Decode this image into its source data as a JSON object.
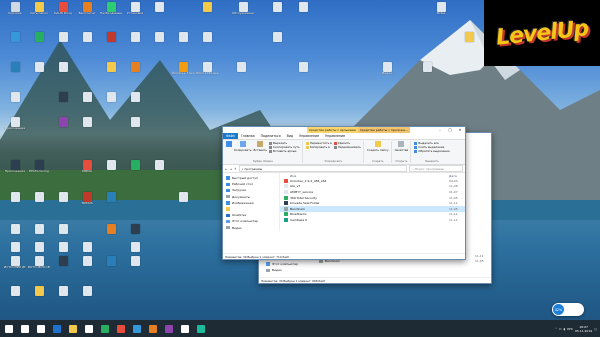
{
  "logo": {
    "text": "LevelUp"
  },
  "desktop_icons": [
    {
      "label": "Корзина",
      "color": "#cfd8e3"
    },
    {
      "label": "Сеть папок",
      "color": "#f2c94c"
    },
    {
      "label": "DAUD Drive",
      "color": "#e74c3c"
    },
    {
      "label": "Бесплатно",
      "color": "#e67e22"
    },
    {
      "label": "Необходимые MTS",
      "color": "#2ecc71"
    },
    {
      "label": "Установка",
      "color": "#dfe6ee"
    },
    {
      "label": "",
      "color": "#dfe6ee"
    },
    {
      "label": "",
      "color": "#f2c94c"
    },
    {
      "label": "Обслуживание",
      "color": "#dfe6ee"
    },
    {
      "label": "",
      "color": "#dfe6ee"
    },
    {
      "label": "",
      "color": "#dfe6ee"
    },
    {
      "label": "Notes",
      "color": "#dfe6ee"
    },
    {
      "label": "",
      "color": "#3498db"
    },
    {
      "label": "",
      "color": "#27ae60"
    },
    {
      "label": "",
      "color": "#dfe6ee"
    },
    {
      "label": "",
      "color": "#dfe6ee"
    },
    {
      "label": "",
      "color": "#c0392b"
    },
    {
      "label": "",
      "color": "#dfe6ee"
    },
    {
      "label": "",
      "color": "#dfe6ee"
    },
    {
      "label": "",
      "color": "#dfe6ee"
    },
    {
      "label": "",
      "color": "#dfe6ee"
    },
    {
      "label": "",
      "color": "#dfe6ee"
    },
    {
      "label": "",
      "color": "#f2c94c"
    },
    {
      "label": "",
      "color": "#2980b9"
    },
    {
      "label": "",
      "color": "#dfe6ee"
    },
    {
      "label": "",
      "color": "#dfe6ee"
    },
    {
      "label": "",
      "color": "#f2c94c"
    },
    {
      "label": "",
      "color": "#e67e22"
    },
    {
      "label": "Windows 7 версия",
      "color": "#f39c12"
    },
    {
      "label": "Word 2010 версия",
      "color": "#dfe6ee"
    },
    {
      "label": "",
      "color": "#dfe6ee"
    },
    {
      "label": "",
      "color": "#dfe6ee"
    },
    {
      "label": "Видео",
      "color": "#dfe6ee"
    },
    {
      "label": "",
      "color": "#dfe6ee"
    },
    {
      "label": "",
      "color": "#dfe6ee"
    },
    {
      "label": "",
      "color": "#2c3e50"
    },
    {
      "label": "",
      "color": "#dfe6ee"
    },
    {
      "label": "",
      "color": "#dfe6ee"
    },
    {
      "label": "",
      "color": "#dfe6ee"
    },
    {
      "label": "Приложение",
      "color": "#dfe6ee"
    },
    {
      "label": "",
      "color": "#8e44ad"
    },
    {
      "label": "",
      "color": "#dfe6ee"
    },
    {
      "label": "",
      "color": "#dfe6ee"
    },
    {
      "label": "Приложения",
      "color": "#2c3e50"
    },
    {
      "label": "EPCM mining",
      "color": "#2c3e50"
    },
    {
      "label": "MMMA",
      "color": "#e74c3c"
    },
    {
      "label": "",
      "color": "#dfe6ee"
    },
    {
      "label": "",
      "color": "#27ae60"
    },
    {
      "label": "",
      "color": "#dfe6ee"
    },
    {
      "label": "",
      "color": "#dfe6ee"
    },
    {
      "label": "",
      "color": "#dfe6ee"
    },
    {
      "label": "",
      "color": "#dfe6ee"
    },
    {
      "label": "TRIMUS",
      "color": "#c0392b"
    },
    {
      "label": "",
      "color": "#2980b9"
    },
    {
      "label": "",
      "color": "#dfe6ee"
    },
    {
      "label": "",
      "color": "#dfe6ee"
    },
    {
      "label": "",
      "color": "#dfe6ee"
    },
    {
      "label": "",
      "color": "#dfe6ee"
    },
    {
      "label": "",
      "color": "#e67e22"
    },
    {
      "label": "",
      "color": "#2c3e50"
    },
    {
      "label": "",
      "color": "#dfe6ee"
    },
    {
      "label": "",
      "color": "#dfe6ee"
    },
    {
      "label": "",
      "color": "#dfe6ee"
    },
    {
      "label": "",
      "color": "#dfe6ee"
    },
    {
      "label": "",
      "color": "#dfe6ee"
    },
    {
      "label": "ИСТОЧНИК ИНСТРУКЦИЯ",
      "color": "#dfe6ee"
    },
    {
      "label": "ВОТО МОЯ СЕМЬЯ",
      "color": "#dfe6ee"
    },
    {
      "label": "",
      "color": "#2c3e50"
    },
    {
      "label": "",
      "color": "#dfe6ee"
    },
    {
      "label": "",
      "color": "#2980b9"
    },
    {
      "label": "",
      "color": "#dfe6ee"
    },
    {
      "label": "",
      "color": "#dfe6ee"
    },
    {
      "label": "",
      "color": "#f2c94c"
    },
    {
      "label": "",
      "color": "#dfe6ee"
    },
    {
      "label": "",
      "color": "#dfe6ee"
    }
  ],
  "explorer_back": {
    "items": [
      {
        "name": "Kinvade Seal Folder",
        "date": "11-11"
      },
      {
        "name": "Bandicam",
        "date": "11-05"
      },
      {
        "name": "",
        "date": ""
      }
    ],
    "nav": [
      "Этот компьютер",
      "Видео"
    ],
    "status": "Элементов: 30   Выбран 1 элемент: 668 байт"
  },
  "explorer": {
    "title": "программы",
    "context_tabs": [
      "Средства работы с ярлыками",
      "Средства работы с приложе..."
    ],
    "tabs": [
      "Файл",
      "Главная",
      "Поделиться",
      "Вид",
      "Управление",
      "Управление"
    ],
    "ribbon": {
      "clipboard": {
        "pin": "Закрепить на панели быстрого доступа",
        "copy": "Копировать",
        "paste": "Вставить",
        "cut": "Вырезать",
        "copy_path": "Скопировать путь",
        "paste_shortcut": "Вставить ярлык",
        "label": "Буфер обмена"
      },
      "organize": {
        "move": "Переместить в",
        "copy": "Копировать в",
        "delete": "Удалить",
        "rename": "Переименовать",
        "label": "Упорядочить"
      },
      "new": {
        "new_folder": "Создать папку",
        "label": "Создать"
      },
      "open": {
        "properties": "Свойства",
        "label": "Открыть"
      },
      "select": {
        "all": "Выделить все",
        "none": "Снять выделение",
        "invert": "Обратить выделение",
        "label": "Выделить"
      }
    },
    "address": "« программы",
    "search_placeholder": "Поиск: программы",
    "nav": [
      {
        "label": "Быстрый доступ",
        "color": "#3d8ee8"
      },
      {
        "label": "Рабочий стол",
        "color": "#3d8ee8"
      },
      {
        "label": "Загрузки",
        "color": "#3d8ee8"
      },
      {
        "label": "Документы",
        "color": "#9aa4ae"
      },
      {
        "label": "Изображения",
        "color": "#3d8ee8"
      },
      {
        "label": "",
        "color": "#f2c94c"
      },
      {
        "label": "OneDrive",
        "color": "#1e73cf"
      },
      {
        "label": "Этот компьютер",
        "color": "#5aa0e6"
      },
      {
        "label": "Видео",
        "color": "#9aa4ae"
      }
    ],
    "col_name": "Имя",
    "col_date": "Дата",
    "files": [
      {
        "name": "Unlocker_1.9.2_x86_x64",
        "date": "04-03",
        "color": "#e74c3c",
        "selected": false
      },
      {
        "name": "AIA_v3",
        "date": "11-08",
        "color": "#dfe6ee",
        "selected": false
      },
      {
        "name": "AMMYY_service",
        "date": "01-07",
        "color": "#dfe6ee",
        "selected": false
      },
      {
        "name": "360 Total Security",
        "date": "11-05",
        "color": "#27ae60",
        "selected": false
      },
      {
        "name": "Kinvade Seal Folder",
        "date": "11-11",
        "color": "#2c3e50",
        "selected": false
      },
      {
        "name": "Bandicam",
        "date": "11-05",
        "color": "#95a5a6",
        "selected": true
      },
      {
        "name": "BlueStacks",
        "date": "11-11",
        "color": "#27ae60",
        "selected": false
      },
      {
        "name": "Camtasia 9",
        "date": "11-11",
        "color": "#16a085",
        "selected": false
      }
    ],
    "status": "Элементов: 30   Выбран 1 элемент: 714 байт"
  },
  "taskbar": {
    "apps": [
      {
        "name": "start",
        "color": "#ffffff"
      },
      {
        "name": "search",
        "color": "#ffffff"
      },
      {
        "name": "task-view",
        "color": "#ffffff"
      },
      {
        "name": "edge",
        "color": "#1e73cf"
      },
      {
        "name": "explorer",
        "color": "#f2c94c"
      },
      {
        "name": "store",
        "color": "#ffffff"
      },
      {
        "name": "app",
        "color": "#27ae60"
      },
      {
        "name": "app",
        "color": "#e74c3c"
      },
      {
        "name": "app",
        "color": "#3498db"
      },
      {
        "name": "app",
        "color": "#e67e22"
      },
      {
        "name": "app",
        "color": "#8e44ad"
      },
      {
        "name": "app",
        "color": "#ffffff"
      },
      {
        "name": "app",
        "color": "#1abc9c"
      }
    ],
    "lang": "РУС",
    "time": "18:07",
    "date": "05.11.2019"
  },
  "cpu_badge": {
    "value": "42%"
  }
}
